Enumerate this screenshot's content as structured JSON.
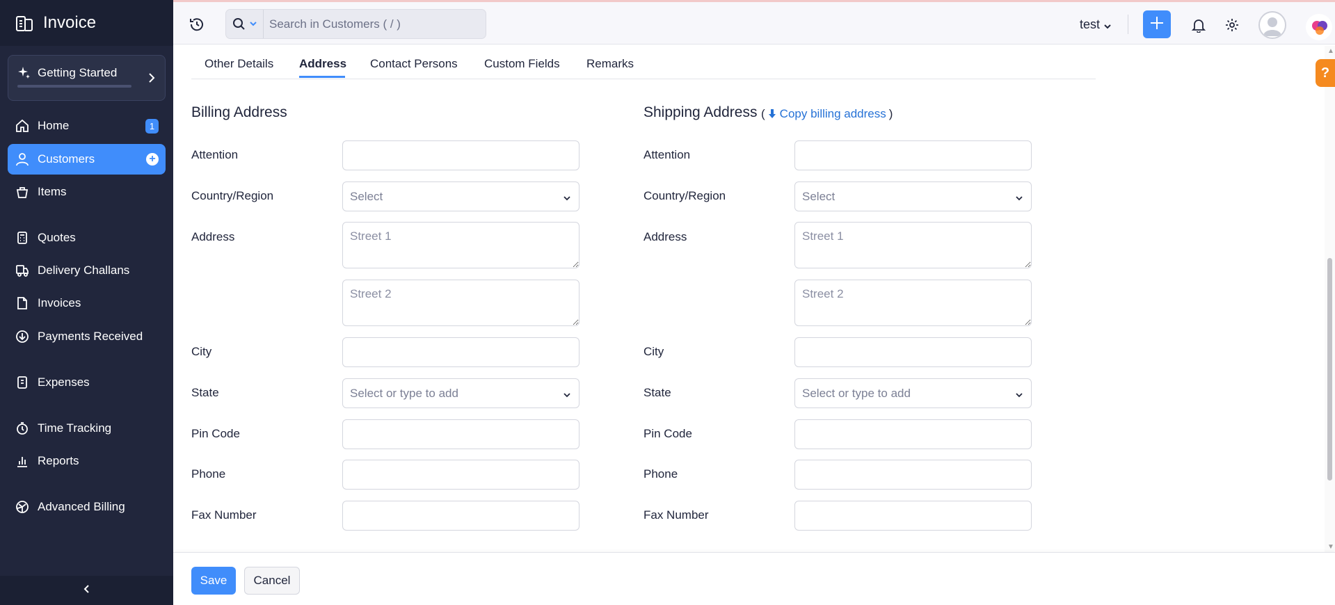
{
  "app": {
    "name": "Invoice"
  },
  "sidebar": {
    "getting_started": "Getting Started",
    "items": [
      {
        "label": "Home",
        "badge": "1"
      },
      {
        "label": "Customers",
        "active": true
      },
      {
        "label": "Items"
      },
      {
        "label": "Quotes"
      },
      {
        "label": "Delivery Challans"
      },
      {
        "label": "Invoices"
      },
      {
        "label": "Payments Received"
      },
      {
        "label": "Expenses"
      },
      {
        "label": "Time Tracking"
      },
      {
        "label": "Reports"
      },
      {
        "label": "Advanced Billing"
      }
    ]
  },
  "topbar": {
    "search_placeholder": "Search in Customers ( / )",
    "org_name": "test"
  },
  "tabs": [
    {
      "label": "Other Details"
    },
    {
      "label": "Address",
      "active": true
    },
    {
      "label": "Contact Persons"
    },
    {
      "label": "Custom Fields"
    },
    {
      "label": "Remarks"
    }
  ],
  "billing": {
    "title": "Billing Address",
    "attention": "Attention",
    "country": "Country/Region",
    "country_placeholder": "Select",
    "address": "Address",
    "street1": "Street 1",
    "street2": "Street 2",
    "city": "City",
    "state": "State",
    "state_placeholder": "Select or type to add",
    "pin": "Pin Code",
    "phone": "Phone",
    "fax": "Fax Number"
  },
  "shipping": {
    "title": "Shipping Address",
    "copy_open": "(",
    "copy_link": "Copy billing address",
    "copy_close": ")",
    "attention": "Attention",
    "country": "Country/Region",
    "country_placeholder": "Select",
    "address": "Address",
    "street1": "Street 1",
    "street2": "Street 2",
    "city": "City",
    "state": "State",
    "state_placeholder": "Select or type to add",
    "pin": "Pin Code",
    "phone": "Phone",
    "fax": "Fax Number"
  },
  "footer": {
    "save": "Save",
    "cancel": "Cancel"
  },
  "help": {
    "label": "?"
  },
  "colors": {
    "accent": "#408dfb",
    "sidebar": "#21263c",
    "link": "#2672d6",
    "help": "#f58a1f"
  }
}
